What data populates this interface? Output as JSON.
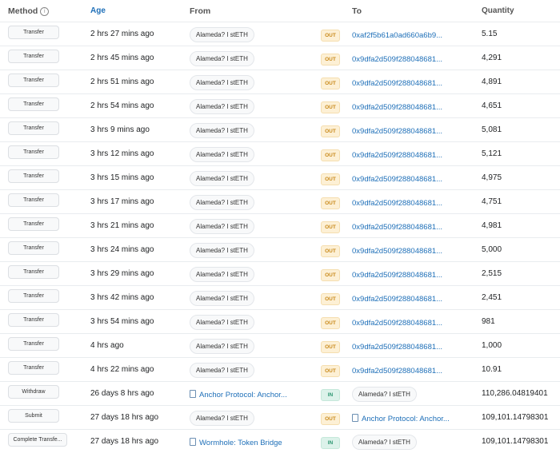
{
  "header": {
    "method": "Method",
    "info_glyph": "i",
    "age": "Age",
    "from": "From",
    "to": "To",
    "quantity": "Quantity"
  },
  "rows": [
    {
      "method": "Transfer",
      "age": "2 hrs 27 mins ago",
      "from": "Alameda? I stETH",
      "dir": "OUT",
      "to": "0xaf2f5b61a0ad660a6b9...",
      "qty": "5.15"
    },
    {
      "method": "Transfer",
      "age": "2 hrs 45 mins ago",
      "from": "Alameda? I stETH",
      "dir": "OUT",
      "to": "0x9dfa2d509f288048681...",
      "qty": "4,291"
    },
    {
      "method": "Transfer",
      "age": "2 hrs 51 mins ago",
      "from": "Alameda? I stETH",
      "dir": "OUT",
      "to": "0x9dfa2d509f288048681...",
      "qty": "4,891"
    },
    {
      "method": "Transfer",
      "age": "2 hrs 54 mins ago",
      "from": "Alameda? I stETH",
      "dir": "OUT",
      "to": "0x9dfa2d509f288048681...",
      "qty": "4,651"
    },
    {
      "method": "Transfer",
      "age": "3 hrs 9 mins ago",
      "from": "Alameda? I stETH",
      "dir": "OUT",
      "to": "0x9dfa2d509f288048681...",
      "qty": "5,081"
    },
    {
      "method": "Transfer",
      "age": "3 hrs 12 mins ago",
      "from": "Alameda? I stETH",
      "dir": "OUT",
      "to": "0x9dfa2d509f288048681...",
      "qty": "5,121"
    },
    {
      "method": "Transfer",
      "age": "3 hrs 15 mins ago",
      "from": "Alameda? I stETH",
      "dir": "OUT",
      "to": "0x9dfa2d509f288048681...",
      "qty": "4,975"
    },
    {
      "method": "Transfer",
      "age": "3 hrs 17 mins ago",
      "from": "Alameda? I stETH",
      "dir": "OUT",
      "to": "0x9dfa2d509f288048681...",
      "qty": "4,751"
    },
    {
      "method": "Transfer",
      "age": "3 hrs 21 mins ago",
      "from": "Alameda? I stETH",
      "dir": "OUT",
      "to": "0x9dfa2d509f288048681...",
      "qty": "4,981"
    },
    {
      "method": "Transfer",
      "age": "3 hrs 24 mins ago",
      "from": "Alameda? I stETH",
      "dir": "OUT",
      "to": "0x9dfa2d509f288048681...",
      "qty": "5,000"
    },
    {
      "method": "Transfer",
      "age": "3 hrs 29 mins ago",
      "from": "Alameda? I stETH",
      "dir": "OUT",
      "to": "0x9dfa2d509f288048681...",
      "qty": "2,515"
    },
    {
      "method": "Transfer",
      "age": "3 hrs 42 mins ago",
      "from": "Alameda? I stETH",
      "dir": "OUT",
      "to": "0x9dfa2d509f288048681...",
      "qty": "2,451"
    },
    {
      "method": "Transfer",
      "age": "3 hrs 54 mins ago",
      "from": "Alameda? I stETH",
      "dir": "OUT",
      "to": "0x9dfa2d509f288048681...",
      "qty": "981"
    },
    {
      "method": "Transfer",
      "age": "4 hrs ago",
      "from": "Alameda? I stETH",
      "dir": "OUT",
      "to": "0x9dfa2d509f288048681...",
      "qty": "1,000"
    },
    {
      "method": "Transfer",
      "age": "4 hrs 22 mins ago",
      "from": "Alameda? I stETH",
      "dir": "OUT",
      "to": "0x9dfa2d509f288048681...",
      "qty": "10.91"
    },
    {
      "method": "Withdraw",
      "age": "26 days 8 hrs ago",
      "from": "Anchor Protocol: Anchor...",
      "dir": "IN",
      "to": "Alameda? I stETH",
      "qty": "110,286.04819401"
    },
    {
      "method": "Submit",
      "age": "27 days 18 hrs ago",
      "from": "Alameda? I stETH",
      "dir": "OUT",
      "to": "Anchor Protocol: Anchor...",
      "qty": "109,101.14798301"
    },
    {
      "method": "Complete Transfe...",
      "age": "27 days 18 hrs ago",
      "from": "Wormhole: Token Bridge",
      "dir": "IN",
      "to": "Alameda? I stETH",
      "qty": "109,101.14798301"
    }
  ],
  "colors": {
    "link": "#1e6fb8",
    "out_badge_bg": "#fdf0d5",
    "out_badge_text": "#c8891a",
    "in_badge_bg": "#dcf2ea",
    "in_badge_text": "#2b9670"
  }
}
